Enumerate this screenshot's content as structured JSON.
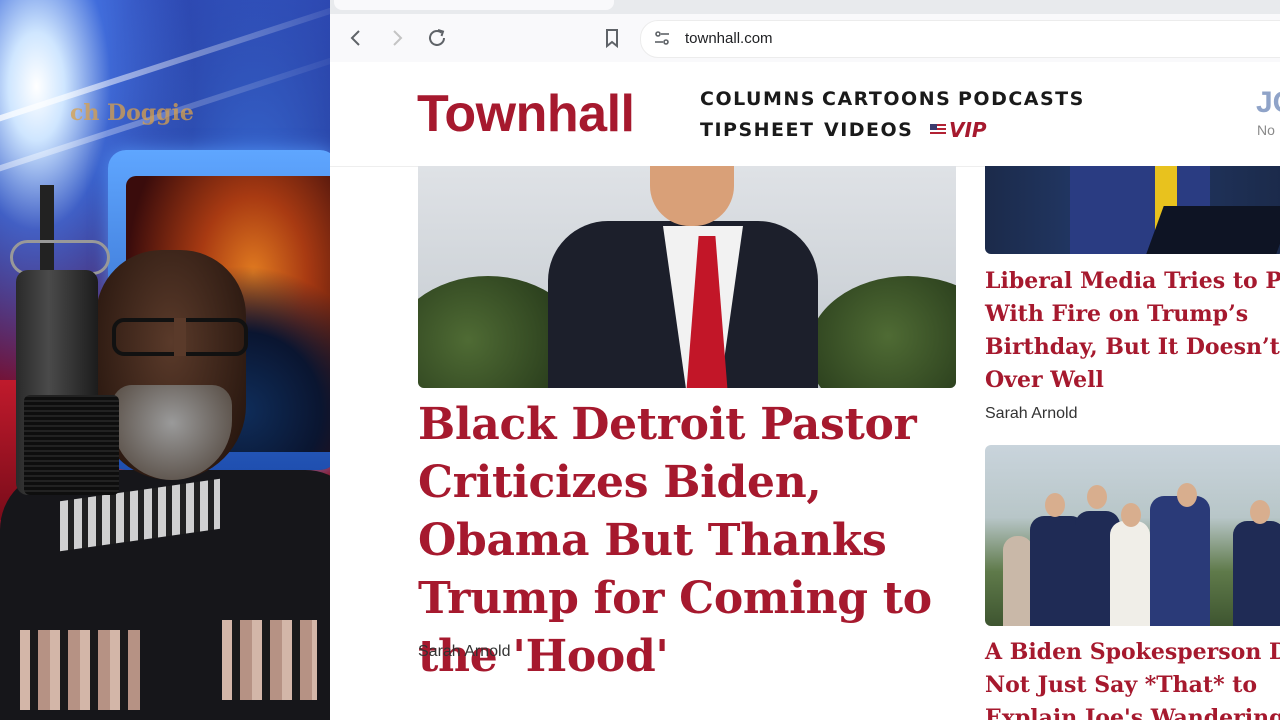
{
  "browser": {
    "url": "townhall.com"
  },
  "site": {
    "logo": "Townhall",
    "nav": {
      "columns": "COLUMNS",
      "cartoons": "CARTOONS",
      "podcasts": "PODCASTS",
      "tipsheet": "TIPSHEET",
      "videos": "VIDEOS",
      "vip": "VIP"
    },
    "join_partial": "JO",
    "join_sub_partial": "No"
  },
  "main_story": {
    "headline": "Black Detroit Pastor Criticizes Biden, Obama But Thanks Trump for Coming to the 'Hood'",
    "author": "Sarah Arnold"
  },
  "sidebar": {
    "stories": [
      {
        "title_lines": [
          "Liberal Media Tries to Play",
          "With Fire on Trump’s",
          "Birthday, But It Doesn’t Go",
          "Over Well"
        ],
        "author": "Sarah Arnold"
      },
      {
        "title_lines": [
          "A Biden Spokesperson Did",
          "Not Just Say *That* to",
          "Explain Joe's Wandering O"
        ]
      }
    ]
  },
  "overlay": {
    "monitor_text": "ch Doggie"
  },
  "colors": {
    "brand": "#a6192e",
    "background": "#ffffff"
  }
}
